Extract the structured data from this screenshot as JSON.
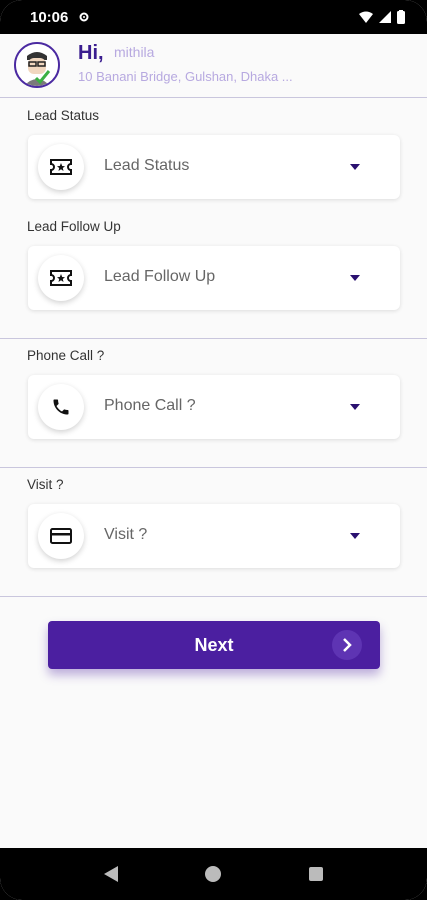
{
  "status_bar": {
    "time": "10:06"
  },
  "header": {
    "greeting": "Hi,",
    "username": "mithila",
    "address": "10 Banani Bridge, Gulshan, Dhaka ..."
  },
  "fields": [
    {
      "label": "Lead Status",
      "value": "Lead Status",
      "icon": "ticket-icon"
    },
    {
      "label": "Lead Follow Up",
      "value": "Lead Follow Up",
      "icon": "ticket-icon"
    },
    {
      "label": "Phone Call ?",
      "value": "Phone Call ?",
      "icon": "phone-icon"
    },
    {
      "label": "Visit ?",
      "value": "Visit ?",
      "icon": "card-icon"
    }
  ],
  "next_button": {
    "label": "Next"
  },
  "colors": {
    "accent": "#4b1fa0",
    "header_text": "#3a1d8f",
    "muted": "#b7a9e0"
  }
}
